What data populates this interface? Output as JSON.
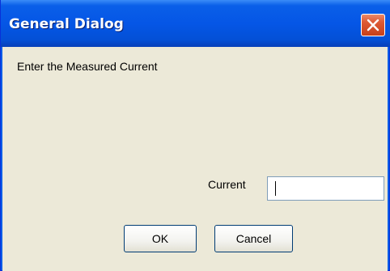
{
  "window": {
    "title": "General Dialog",
    "close_icon": "close-icon",
    "titlebar_color": "#0556e6",
    "close_button_color": "#de5a36"
  },
  "dialog": {
    "prompt": "Enter the Measured Current",
    "field_label": "Current",
    "field_value": "",
    "ok_label": "OK",
    "cancel_label": "Cancel",
    "background_color": "#ece9d8"
  }
}
